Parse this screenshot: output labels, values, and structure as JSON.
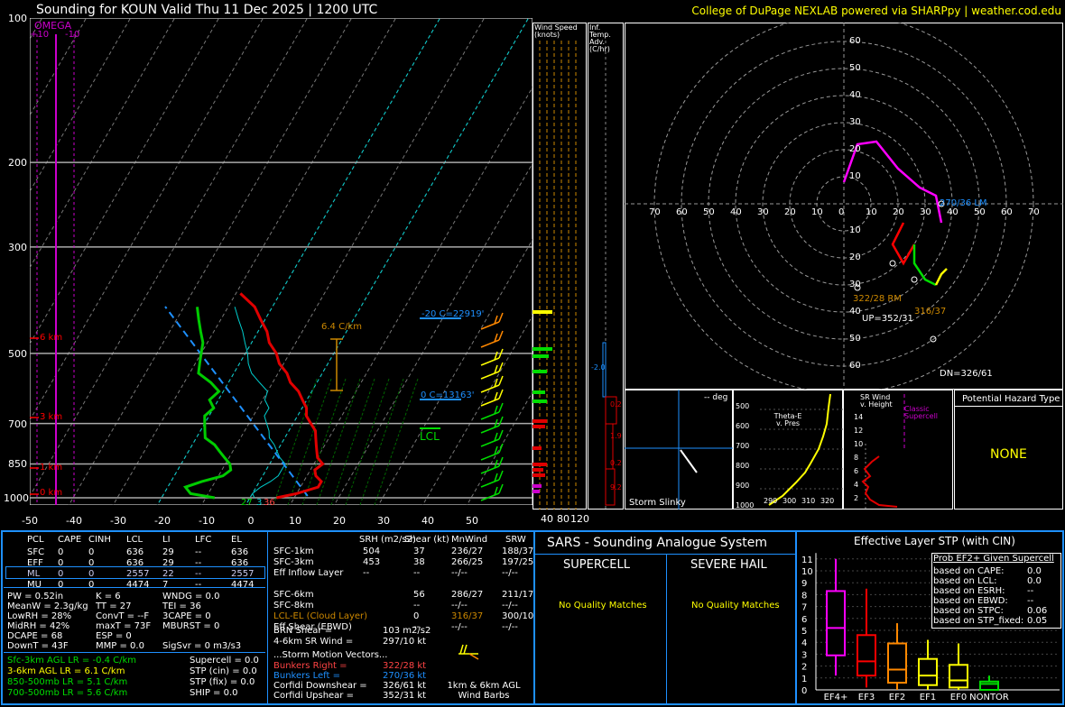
{
  "header": {
    "title": "Sounding for KOUN Valid  Thu 11 Dec 2025 | 1200 UTC",
    "credit": "College of DuPage NEXLAB powered via SHARPpy | weather.cod.edu"
  },
  "colors": {
    "temperature": "#e00000",
    "dewpoint": "#00cc00",
    "wetbulb": "#00cccc",
    "parcel": "#1e90ff",
    "omega": "#cc00cc",
    "hodo_0_3": "#ff0000",
    "hodo_3_6": "#00dd00",
    "hodo_6_9": "#ffff00",
    "hodo_9_12": "#ff00ff",
    "accent_yellow": "#ffff00",
    "panel_border": "#1e90ff"
  },
  "skewt": {
    "pressure_labels": [
      "100",
      "200",
      "300",
      "500",
      "700",
      "850",
      "1000"
    ],
    "temp_labels": [
      "-50",
      "-40",
      "-30",
      "-20",
      "-10",
      "0",
      "10",
      "20",
      "30",
      "40",
      "50"
    ],
    "omega_title": "OMEGA",
    "omega_ticks": [
      "+10",
      "-10"
    ],
    "height_labels": [
      "6 km",
      "3 km",
      "1 km",
      "0 km"
    ],
    "lapse_label": "6.4 C/km",
    "isotherm_m20": "-20 C=22919'",
    "isotherm_0": "0 C=13163'",
    "lcl_label": "LCL",
    "sfc_temp": "27",
    "sfc_dewp": "3",
    "sfc_wetbulb": "36",
    "mixing_ratio_labels": [
      "6",
      "10",
      "14",
      "18",
      "22",
      "26",
      "30",
      "34"
    ]
  },
  "chart_data": [
    {
      "type": "line",
      "title": "Sounding for KOUN Valid  Thu 11 Dec 2025 | 1200 UTC",
      "xlabel": "",
      "ylabel": "",
      "yscale": "log",
      "ylim": [
        1000,
        100
      ],
      "xlim": [
        -50,
        50
      ],
      "series": [
        {
          "name": "",
          "pressure": [
            1000,
            980,
            950,
            925,
            900,
            875,
            850,
            825,
            800,
            775,
            750,
            725,
            700,
            675,
            650,
            625,
            600,
            575,
            550,
            525,
            500,
            475,
            450,
            425,
            400,
            375
          ],
          "values": [
            6,
            10,
            14,
            14,
            12,
            11,
            12,
            10,
            9,
            8,
            7,
            6,
            4,
            2,
            1,
            -1,
            -3,
            -6,
            -8,
            -11,
            -13,
            -16,
            -18,
            -21,
            -24,
            -29
          ]
        },
        {
          "name": "",
          "pressure": [
            1000,
            980,
            950,
            925,
            900,
            875,
            850,
            825,
            800,
            775,
            750,
            725,
            700,
            675,
            650,
            625,
            600,
            575,
            550,
            525,
            500,
            475,
            450,
            425,
            400
          ],
          "values": [
            -8,
            -14,
            -16,
            -13,
            -9,
            -8,
            -9,
            -11,
            -13,
            -15,
            -18,
            -19,
            -20,
            -21,
            -20,
            -22,
            -21,
            -24,
            -28,
            -29,
            -30,
            -31,
            -33,
            -35,
            -37
          ]
        }
      ]
    },
    {
      "type": "scatter",
      "title": "",
      "xlabel": "",
      "ylabel": "",
      "xlim": [
        -80,
        80
      ],
      "ylim": [
        -60,
        60
      ],
      "rings": [
        10,
        20,
        30,
        40,
        50,
        60,
        70
      ],
      "series": [
        {
          "name": "",
          "x": [
            22,
            18,
            22,
            26
          ],
          "y": [
            -7,
            -15,
            -22,
            -15
          ]
        },
        {
          "name": "",
          "x": [
            26,
            26,
            30,
            34
          ],
          "y": [
            -15,
            -22,
            -28,
            -30
          ]
        },
        {
          "name": "",
          "x": [
            34,
            36,
            38
          ],
          "y": [
            -30,
            -26,
            -24
          ]
        },
        {
          "name": "",
          "x": [
            36,
            34,
            28,
            20,
            12,
            5,
            0
          ],
          "y": [
            -7,
            3,
            6,
            13,
            23,
            22,
            8
          ]
        }
      ],
      "points": [
        {
          "label": "322/28 RM",
          "x": 18,
          "y": -22
        },
        {
          "label": "316/37",
          "x": 26,
          "y": -28
        },
        {
          "label": "UP=352/31",
          "x": 5,
          "y": -31
        },
        {
          "label": "DN=326/61",
          "x": 33,
          "y": -50
        },
        {
          "label": "270/36 LM",
          "x": 36,
          "y": 0
        }
      ]
    }
  ],
  "wind_speed_panel": {
    "title": "Wind Speed (knots)",
    "ticks": [
      "40",
      "80",
      "120"
    ]
  },
  "temp_adv_panel": {
    "title": "Inf. Temp. Adv. (C/hr)",
    "values": [
      "-2.0",
      "0.2",
      "1.9",
      "0.2",
      "9.2"
    ]
  },
  "hodograph": {
    "ring_labels_up": [
      "60",
      "50",
      "40",
      "30",
      "20",
      "10"
    ],
    "ring_labels_down": [
      "10",
      "20",
      "30",
      "40",
      "50",
      "60"
    ],
    "ring_labels_x": [
      "70",
      "60",
      "50",
      "40",
      "30",
      "20",
      "10",
      "0",
      "10",
      "20",
      "30",
      "40",
      "50",
      "60",
      "70"
    ],
    "rm_label": "322/28 RM",
    "lm_label": "270/36 LM",
    "rm2_label": "316/37",
    "up_label": "UP=352/31",
    "dn_label": "DN=326/61"
  },
  "slinky": {
    "deg": "-- deg",
    "label": "Storm Slinky"
  },
  "theta_panel": {
    "title": "Theta-E v. Pres",
    "y_labels": [
      "500",
      "600",
      "700",
      "800",
      "900",
      "1000"
    ],
    "x_labels": [
      "290",
      "300",
      "310",
      "320"
    ]
  },
  "srwind_panel": {
    "title": "SR Wind v. Height",
    "classic_label": "Classic Supercell",
    "y_labels": [
      "14",
      "12",
      "10",
      "8",
      "6",
      "4",
      "2"
    ]
  },
  "hazard": {
    "title": "Potential Hazard Type",
    "value": "NONE"
  },
  "parcels": {
    "headers": [
      "PCL",
      "CAPE",
      "CINH",
      "LCL",
      "LI",
      "LFC",
      "EL"
    ],
    "rows": [
      [
        "SFC",
        "0",
        "0",
        "636",
        "29",
        "--",
        "636"
      ],
      [
        "EFF",
        "0",
        "0",
        "636",
        "29",
        "--",
        "636"
      ],
      [
        "ML",
        "0",
        "0",
        "2557",
        "22",
        "--",
        "2557"
      ],
      [
        "MU",
        "0",
        "0",
        "4474",
        "7",
        "--",
        "4474"
      ]
    ]
  },
  "indices": {
    "col1": [
      "PW = 0.52in",
      "MeanW = 2.3g/kg",
      "LowRH = 28%",
      "MidRH = 42%",
      "DCAPE = 68",
      "DownT = 43F"
    ],
    "col2": [
      "K = 6",
      "TT = 27",
      "ConvT = --F",
      "maxT = 73F",
      "ESP = 0",
      "MMP = 0.0"
    ],
    "col3": [
      "WNDG = 0.0",
      "TEI = 36",
      "3CAPE = 0",
      "MBURST = 0",
      "",
      "SigSvr = 0 m3/s3"
    ]
  },
  "lapse_rates": [
    "Sfc-3km AGL LR = -0.4 C/km",
    "3-6km AGL LR = 6.1 C/km",
    "850-500mb LR = 5.1 C/km",
    "700-500mb LR = 5.6 C/km"
  ],
  "composites": [
    "Supercell = 0.0",
    "STP (cin) = 0.0",
    "STP (fix) = 0.0",
    "SHIP = 0.0"
  ],
  "kinematics": {
    "headers": [
      "SRH (m2/s2)",
      "Shear (kt)",
      "MnWind",
      "SRW"
    ],
    "rows": [
      [
        "SFC-1km",
        "504",
        "37",
        "236/27",
        "188/37"
      ],
      [
        "SFC-3km",
        "453",
        "38",
        "266/25",
        "197/25"
      ],
      [
        "Eff Inflow Layer",
        "--",
        "--",
        "--/--",
        "--/--"
      ],
      [
        "",
        "",
        "",
        "",
        ""
      ],
      [
        "SFC-6km",
        "",
        "56",
        "286/27",
        "211/17"
      ],
      [
        "SFC-8km",
        "",
        "--",
        "--/--",
        "--/--"
      ],
      [
        "LCL-EL (Cloud Layer)",
        "",
        "0",
        "316/37",
        "300/10"
      ],
      [
        "Eff Shear (EBWD)",
        "",
        "--",
        "--/--",
        "--/--"
      ]
    ],
    "brn_shear": "BRN Shear =",
    "brn_value": "103 m2/s2",
    "srwind_46": "4-6km SR Wind =",
    "srwind_46_value": "297/10 kt",
    "storm_motion": "...Storm Motion Vectors...",
    "motions": [
      [
        "Bunkers Right =",
        "322/28 kt"
      ],
      [
        "Bunkers Left =",
        "270/36 kt"
      ],
      [
        "Corfidi Downshear =",
        "326/61 kt"
      ],
      [
        "Corfidi Upshear =",
        "352/31 kt"
      ]
    ],
    "barb_note": "1km & 6km AGL Wind Barbs"
  },
  "sars": {
    "title": "SARS - Sounding Analogue System",
    "supercell": "SUPERCELL",
    "hail": "SEVERE HAIL",
    "supercell_match": "No Quality Matches",
    "hail_match": "No Quality Matches"
  },
  "stp": {
    "title": "Effective Layer STP (with CIN)",
    "y_ticks": [
      "0",
      "1",
      "2",
      "3",
      "4",
      "5",
      "6",
      "7",
      "8",
      "9",
      "10",
      "11"
    ],
    "categories": [
      "EF4+",
      "EF3",
      "EF2",
      "EF1",
      "EF0",
      "NONTOR"
    ],
    "prob_title": "Prob EF2+ Given Supercell",
    "prob_rows": [
      [
        "based on CAPE:",
        "0.0"
      ],
      [
        "based on LCL:",
        "0.0"
      ],
      [
        "based on ESRH:",
        "--"
      ],
      [
        "based on EBWD:",
        "--"
      ],
      [
        "based on STPC:",
        "0.06"
      ],
      [
        "based on STP_fixed:",
        "0.05"
      ]
    ]
  }
}
